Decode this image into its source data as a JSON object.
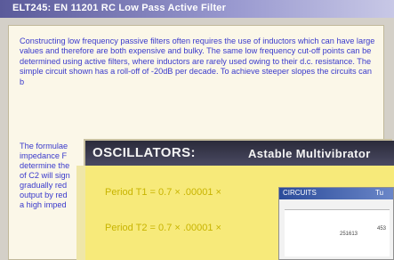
{
  "window": {
    "title": "ELT245: EN 11201    RC Low Pass Active Filter"
  },
  "doc": {
    "paragraph1": "Constructing low frequency passive filters often requires the use of inductors which can have large values and therefore are both expensive and bulky. The same low frequency cut-off points can be determined using active filters, where inductors are rarely used owing to their d.c. resistance. The simple circuit shown has a roll-off of -20dB per decade. To achieve steeper slopes the circuits can b",
    "paragraph2_lines": [
      "The formulae",
      "impedance F",
      "determine the",
      "of C2 will sign",
      "gradually red",
      "output by red",
      "a high imped"
    ]
  },
  "osc": {
    "title": "OSCILLATORS:",
    "subtitle": "Astable Multivibrator",
    "formula1": "Period T1 = 0.7 × .00001 ×",
    "formula2": "Period T2 = 0.7 × .00001 ×"
  },
  "circuit": {
    "title": "CIRCUITS",
    "tab": "Tu",
    "label1": "251613",
    "label2": "453"
  },
  "colors": {
    "doc_text": "#3a3acc",
    "formula_text": "#c8b400",
    "osc_bg": "#f7ea7a"
  }
}
